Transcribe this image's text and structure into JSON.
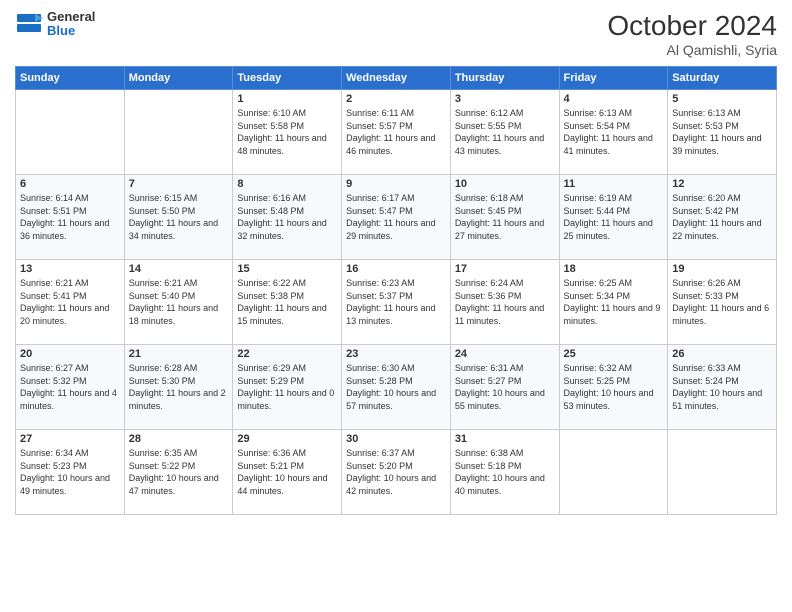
{
  "logo": {
    "general": "General",
    "blue": "Blue"
  },
  "title": "October 2024",
  "subtitle": "Al Qamishli, Syria",
  "headers": [
    "Sunday",
    "Monday",
    "Tuesday",
    "Wednesday",
    "Thursday",
    "Friday",
    "Saturday"
  ],
  "weeks": [
    [
      {
        "day": "",
        "sunrise": "",
        "sunset": "",
        "daylight": ""
      },
      {
        "day": "",
        "sunrise": "",
        "sunset": "",
        "daylight": ""
      },
      {
        "day": "1",
        "sunrise": "Sunrise: 6:10 AM",
        "sunset": "Sunset: 5:58 PM",
        "daylight": "Daylight: 11 hours and 48 minutes."
      },
      {
        "day": "2",
        "sunrise": "Sunrise: 6:11 AM",
        "sunset": "Sunset: 5:57 PM",
        "daylight": "Daylight: 11 hours and 46 minutes."
      },
      {
        "day": "3",
        "sunrise": "Sunrise: 6:12 AM",
        "sunset": "Sunset: 5:55 PM",
        "daylight": "Daylight: 11 hours and 43 minutes."
      },
      {
        "day": "4",
        "sunrise": "Sunrise: 6:13 AM",
        "sunset": "Sunset: 5:54 PM",
        "daylight": "Daylight: 11 hours and 41 minutes."
      },
      {
        "day": "5",
        "sunrise": "Sunrise: 6:13 AM",
        "sunset": "Sunset: 5:53 PM",
        "daylight": "Daylight: 11 hours and 39 minutes."
      }
    ],
    [
      {
        "day": "6",
        "sunrise": "Sunrise: 6:14 AM",
        "sunset": "Sunset: 5:51 PM",
        "daylight": "Daylight: 11 hours and 36 minutes."
      },
      {
        "day": "7",
        "sunrise": "Sunrise: 6:15 AM",
        "sunset": "Sunset: 5:50 PM",
        "daylight": "Daylight: 11 hours and 34 minutes."
      },
      {
        "day": "8",
        "sunrise": "Sunrise: 6:16 AM",
        "sunset": "Sunset: 5:48 PM",
        "daylight": "Daylight: 11 hours and 32 minutes."
      },
      {
        "day": "9",
        "sunrise": "Sunrise: 6:17 AM",
        "sunset": "Sunset: 5:47 PM",
        "daylight": "Daylight: 11 hours and 29 minutes."
      },
      {
        "day": "10",
        "sunrise": "Sunrise: 6:18 AM",
        "sunset": "Sunset: 5:45 PM",
        "daylight": "Daylight: 11 hours and 27 minutes."
      },
      {
        "day": "11",
        "sunrise": "Sunrise: 6:19 AM",
        "sunset": "Sunset: 5:44 PM",
        "daylight": "Daylight: 11 hours and 25 minutes."
      },
      {
        "day": "12",
        "sunrise": "Sunrise: 6:20 AM",
        "sunset": "Sunset: 5:42 PM",
        "daylight": "Daylight: 11 hours and 22 minutes."
      }
    ],
    [
      {
        "day": "13",
        "sunrise": "Sunrise: 6:21 AM",
        "sunset": "Sunset: 5:41 PM",
        "daylight": "Daylight: 11 hours and 20 minutes."
      },
      {
        "day": "14",
        "sunrise": "Sunrise: 6:21 AM",
        "sunset": "Sunset: 5:40 PM",
        "daylight": "Daylight: 11 hours and 18 minutes."
      },
      {
        "day": "15",
        "sunrise": "Sunrise: 6:22 AM",
        "sunset": "Sunset: 5:38 PM",
        "daylight": "Daylight: 11 hours and 15 minutes."
      },
      {
        "day": "16",
        "sunrise": "Sunrise: 6:23 AM",
        "sunset": "Sunset: 5:37 PM",
        "daylight": "Daylight: 11 hours and 13 minutes."
      },
      {
        "day": "17",
        "sunrise": "Sunrise: 6:24 AM",
        "sunset": "Sunset: 5:36 PM",
        "daylight": "Daylight: 11 hours and 11 minutes."
      },
      {
        "day": "18",
        "sunrise": "Sunrise: 6:25 AM",
        "sunset": "Sunset: 5:34 PM",
        "daylight": "Daylight: 11 hours and 9 minutes."
      },
      {
        "day": "19",
        "sunrise": "Sunrise: 6:26 AM",
        "sunset": "Sunset: 5:33 PM",
        "daylight": "Daylight: 11 hours and 6 minutes."
      }
    ],
    [
      {
        "day": "20",
        "sunrise": "Sunrise: 6:27 AM",
        "sunset": "Sunset: 5:32 PM",
        "daylight": "Daylight: 11 hours and 4 minutes."
      },
      {
        "day": "21",
        "sunrise": "Sunrise: 6:28 AM",
        "sunset": "Sunset: 5:30 PM",
        "daylight": "Daylight: 11 hours and 2 minutes."
      },
      {
        "day": "22",
        "sunrise": "Sunrise: 6:29 AM",
        "sunset": "Sunset: 5:29 PM",
        "daylight": "Daylight: 11 hours and 0 minutes."
      },
      {
        "day": "23",
        "sunrise": "Sunrise: 6:30 AM",
        "sunset": "Sunset: 5:28 PM",
        "daylight": "Daylight: 10 hours and 57 minutes."
      },
      {
        "day": "24",
        "sunrise": "Sunrise: 6:31 AM",
        "sunset": "Sunset: 5:27 PM",
        "daylight": "Daylight: 10 hours and 55 minutes."
      },
      {
        "day": "25",
        "sunrise": "Sunrise: 6:32 AM",
        "sunset": "Sunset: 5:25 PM",
        "daylight": "Daylight: 10 hours and 53 minutes."
      },
      {
        "day": "26",
        "sunrise": "Sunrise: 6:33 AM",
        "sunset": "Sunset: 5:24 PM",
        "daylight": "Daylight: 10 hours and 51 minutes."
      }
    ],
    [
      {
        "day": "27",
        "sunrise": "Sunrise: 6:34 AM",
        "sunset": "Sunset: 5:23 PM",
        "daylight": "Daylight: 10 hours and 49 minutes."
      },
      {
        "day": "28",
        "sunrise": "Sunrise: 6:35 AM",
        "sunset": "Sunset: 5:22 PM",
        "daylight": "Daylight: 10 hours and 47 minutes."
      },
      {
        "day": "29",
        "sunrise": "Sunrise: 6:36 AM",
        "sunset": "Sunset: 5:21 PM",
        "daylight": "Daylight: 10 hours and 44 minutes."
      },
      {
        "day": "30",
        "sunrise": "Sunrise: 6:37 AM",
        "sunset": "Sunset: 5:20 PM",
        "daylight": "Daylight: 10 hours and 42 minutes."
      },
      {
        "day": "31",
        "sunrise": "Sunrise: 6:38 AM",
        "sunset": "Sunset: 5:18 PM",
        "daylight": "Daylight: 10 hours and 40 minutes."
      },
      {
        "day": "",
        "sunrise": "",
        "sunset": "",
        "daylight": ""
      },
      {
        "day": "",
        "sunrise": "",
        "sunset": "",
        "daylight": ""
      }
    ]
  ]
}
